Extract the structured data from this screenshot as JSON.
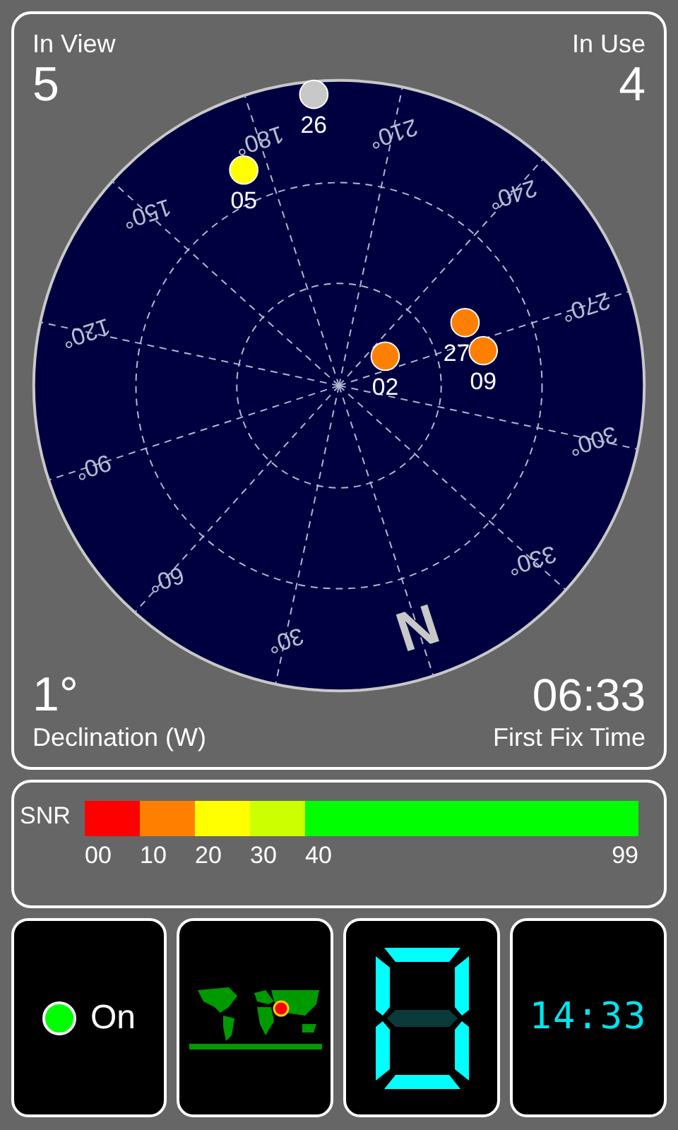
{
  "sky": {
    "in_view_label": "In View",
    "in_view": "5",
    "in_use_label": "In Use",
    "in_use": "4",
    "azimuth_labels": [
      "30°",
      "60°",
      "90°",
      "120°",
      "150°",
      "180°",
      "210°",
      "240°",
      "270°",
      "300°",
      "330°"
    ],
    "north": "N",
    "satellites": [
      {
        "id": "26",
        "color": "#c8c8c8"
      },
      {
        "id": "05",
        "color": "#ffff00"
      },
      {
        "id": "02",
        "color": "#ff8000"
      },
      {
        "id": "27",
        "color": "#ff8000"
      },
      {
        "id": "09",
        "color": "#ff8000"
      }
    ],
    "declination": "1°",
    "declination_label": "Declination (W)",
    "fix_time": "06:33",
    "fix_time_label": "First Fix Time"
  },
  "snr": {
    "label": "SNR",
    "segments": [
      {
        "label": "00",
        "color": "#ff0000"
      },
      {
        "label": "10",
        "color": "#ff8000"
      },
      {
        "label": "20",
        "color": "#ffff00"
      },
      {
        "label": "30",
        "color": "#ccff00"
      },
      {
        "label": "40",
        "color": "#00ff00"
      }
    ],
    "max": "99"
  },
  "tiles": {
    "status": {
      "on": true,
      "label": "On"
    },
    "clock": "14:33"
  }
}
